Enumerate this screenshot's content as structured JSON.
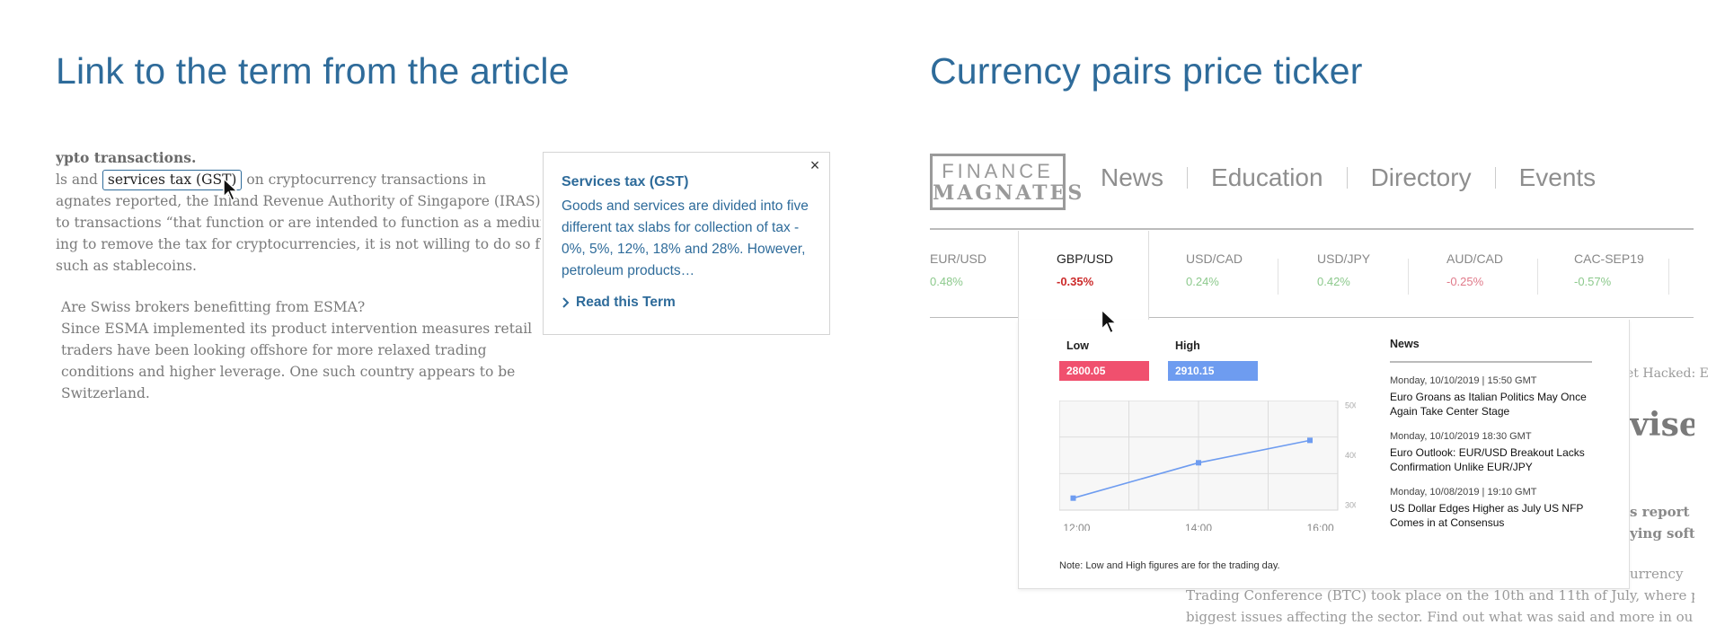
{
  "left_section": {
    "title": "Link to the term from the article",
    "article": {
      "heading_fragment": "ypto transactions.",
      "line1_before": "ls and ",
      "term_link": "services tax (GST)",
      "line1_after": " on cryptocurrency transactions in",
      "line2": "agnates reported, the Inland Revenue Authority of Singapore (IRAS)",
      "line3": "to transactions “that function or are intended to function as a medium",
      "line4": "ing to remove the tax for cryptocurrencies, it is not willing to do so for",
      "line5": "such as stablecoins.",
      "para2_heading": "Are Swiss brokers benefitting from ESMA?",
      "para2_body": "Since ESMA implemented its product intervention measures retail traders have been looking offshore for more relaxed trading conditions and higher leverage. One such country appears to be Switzerland."
    },
    "tooltip": {
      "close_glyph": "×",
      "term_title": "Services tax (GST)",
      "description": "Goods and services are divided into five different tax slabs for collection of tax - 0%, 5%, 12%, 18% and 28%. However, petroleum products…",
      "read_more_label": "Read this Term"
    }
  },
  "right_section": {
    "title": "Currency pairs price ticker",
    "logo": {
      "line1": "FINANCE",
      "line2": "MAGNATES"
    },
    "nav": [
      "News",
      "Education",
      "Directory",
      "Events"
    ],
    "ticker": [
      {
        "pair": "EUR/USD",
        "change": "0.48%",
        "color": "#8cc98c"
      },
      {
        "pair": "GBP/USD",
        "change": "-0.35%",
        "color": "#cc2b2b"
      },
      {
        "pair": "USD/CAD",
        "change": "0.24%",
        "color": "#8cc98c"
      },
      {
        "pair": "USD/JPY",
        "change": "0.42%",
        "color": "#8cc98c"
      },
      {
        "pair": "AUD/CAD",
        "change": "-0.25%",
        "color": "#e07a8a"
      },
      {
        "pair": "CAC-SEP19",
        "change": "-0.57%",
        "color": "#8cc98c"
      }
    ],
    "dropdown": {
      "low_label": "Low",
      "low_value": "2800.05",
      "low_color": "#f0506e",
      "high_label": "High",
      "high_value": "2910.15",
      "high_color": "#6e9cf0",
      "note": "Note: Low and High figures are for the trading day.",
      "news_title": "News",
      "news": [
        {
          "date": "Monday, 10/10/2019 | 15:50 GMT",
          "headline": "Euro Groans as Italian Politics May Once Again Take Center Stage"
        },
        {
          "date": "Monday, 10/10/2019 18:30 GMT",
          "headline": "Euro Outlook: EUR/USD Breakout Lacks Confirmation Unlike EUR/JPY"
        },
        {
          "date": "Monday, 10/08/2019 | 19:10 GMT",
          "headline": "US Dollar Edges Higher as July US NFP Comes in at Consensus"
        }
      ]
    },
    "background_fragments": {
      "hacked": "et Hacked: E",
      "vised": "visec",
      "report": "s report fc",
      "soft": "ying soft g",
      "currency": "urrency",
      "btc": "Trading Conference (BTC) took place on the 10th and 11th of July, where pr",
      "issues": "biggest issues affecting the sector. Find out what was said and more in ou"
    }
  },
  "chart_data": {
    "type": "line",
    "x": [
      "12:00",
      "14:00",
      "16:00"
    ],
    "x_values": [
      12.2,
      14.0,
      15.6
    ],
    "series": [
      {
        "values": [
          314,
          385,
          430
        ]
      }
    ],
    "y_ticks": [
      300,
      400,
      500
    ],
    "xlim": [
      12.0,
      16.0
    ],
    "ylim": [
      290,
      510
    ],
    "grid": true,
    "line_color": "#6e9cf0"
  }
}
